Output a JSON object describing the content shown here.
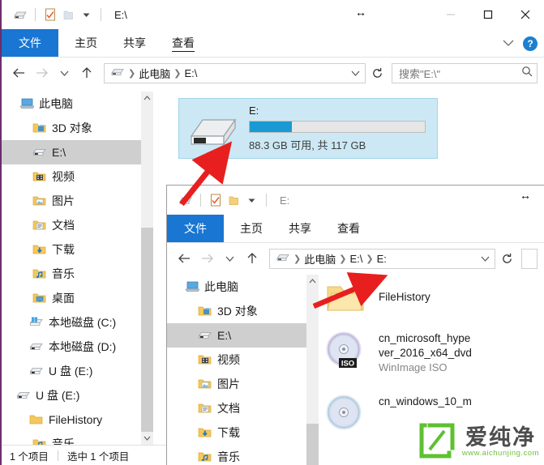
{
  "outer_window": {
    "title": "E:\\",
    "quick_access": [
      {
        "name": "drive-icon",
        "label": ""
      },
      {
        "name": "properties-icon",
        "label": ""
      },
      {
        "name": "new-folder-icon",
        "label": ""
      },
      {
        "name": "customize-dropdown-icon",
        "label": "▾"
      }
    ],
    "caption": {
      "minimize": "—",
      "maximize": "☐",
      "close": "✕"
    },
    "ribbon": {
      "tabs": [
        {
          "label": "文件",
          "active": true
        },
        {
          "label": "主页",
          "active": false
        },
        {
          "label": "共享",
          "active": false
        },
        {
          "label": "查看",
          "active": false
        }
      ],
      "collapse_label": "⌄",
      "help_label": "?"
    },
    "nav": {
      "back": "←",
      "forward": "→",
      "recent": "⌄",
      "up": "↑",
      "refresh_title": "刷新",
      "breadcrumbs": [
        "此电脑",
        "E:\\"
      ],
      "dropdown": "⌄"
    },
    "search": {
      "placeholder": "搜索\"E:\\\"",
      "icon": "search-icon"
    },
    "tree": [
      {
        "label": "此电脑",
        "icon": "this-pc-icon",
        "indent": 22,
        "selected": false
      },
      {
        "label": "3D 对象",
        "icon": "folder-3d-icon",
        "indent": 38,
        "selected": false
      },
      {
        "label": "E:\\",
        "icon": "usb-drive-icon",
        "indent": 38,
        "selected": true
      },
      {
        "label": "视频",
        "icon": "videos-folder-icon",
        "indent": 38,
        "selected": false
      },
      {
        "label": "图片",
        "icon": "pictures-folder-icon",
        "indent": 38,
        "selected": false
      },
      {
        "label": "文档",
        "icon": "documents-folder-icon",
        "indent": 38,
        "selected": false
      },
      {
        "label": "下载",
        "icon": "downloads-folder-icon",
        "indent": 38,
        "selected": false
      },
      {
        "label": "音乐",
        "icon": "music-folder-icon",
        "indent": 38,
        "selected": false
      },
      {
        "label": "桌面",
        "icon": "desktop-folder-icon",
        "indent": 38,
        "selected": false
      },
      {
        "label": "本地磁盘 (C:)",
        "icon": "windows-drive-icon",
        "indent": 34,
        "selected": false
      },
      {
        "label": "本地磁盘 (D:)",
        "icon": "hard-drive-icon",
        "indent": 34,
        "selected": false
      },
      {
        "label": "U 盘 (E:)",
        "icon": "usb-drive-icon",
        "indent": 34,
        "selected": false
      },
      {
        "label": "U 盘 (E:)",
        "icon": "usb-drive-icon",
        "indent": 18,
        "selected": false
      },
      {
        "label": "FileHistory",
        "icon": "folder-icon",
        "indent": 34,
        "selected": false
      },
      {
        "label": "音乐",
        "icon": "music-folder-icon",
        "indent": 38,
        "selected": false
      }
    ],
    "drive_tile": {
      "name": "E:",
      "free_text": "88.3 GB 可用, 共 117 GB",
      "used_percent": 24,
      "fill_color": "#1a9ad4",
      "selected_bg": "#cce8f4"
    },
    "status": {
      "count": "1 个项目",
      "selected": "选中 1 个项目"
    }
  },
  "inner_window": {
    "title": "E:",
    "quick_access": [
      {
        "name": "drive-icon",
        "label": ""
      },
      {
        "name": "properties-icon",
        "label": ""
      },
      {
        "name": "new-folder-icon",
        "label": ""
      },
      {
        "name": "customize-dropdown-icon",
        "label": "▾"
      }
    ],
    "ribbon": {
      "tabs": [
        {
          "label": "文件",
          "active": true
        },
        {
          "label": "主页",
          "active": false
        },
        {
          "label": "共享",
          "active": false
        },
        {
          "label": "查看",
          "active": false
        }
      ]
    },
    "nav": {
      "back": "←",
      "forward": "→",
      "recent": "⌄",
      "up": "↑",
      "breadcrumbs": [
        "此电脑",
        "E:\\",
        "E:"
      ],
      "dropdown": "⌄"
    },
    "tree": [
      {
        "label": "此电脑",
        "icon": "this-pc-icon",
        "indent": 22,
        "selected": false
      },
      {
        "label": "3D 对象",
        "icon": "folder-3d-icon",
        "indent": 38,
        "selected": false
      },
      {
        "label": "E:\\",
        "icon": "usb-drive-icon",
        "indent": 38,
        "selected": true
      },
      {
        "label": "视频",
        "icon": "videos-folder-icon",
        "indent": 38,
        "selected": false
      },
      {
        "label": "图片",
        "icon": "pictures-folder-icon",
        "indent": 38,
        "selected": false
      },
      {
        "label": "文档",
        "icon": "documents-folder-icon",
        "indent": 38,
        "selected": false
      },
      {
        "label": "下载",
        "icon": "downloads-folder-icon",
        "indent": 38,
        "selected": false
      },
      {
        "label": "音乐",
        "icon": "music-folder-icon",
        "indent": 38,
        "selected": false
      }
    ],
    "files": [
      {
        "name": "FileHistory",
        "sub": "",
        "icon": "folder-icon"
      },
      {
        "name": "cn_microsoft_hype",
        "name2": "ver_2016_x64_dvd",
        "sub": "WinImage ISO",
        "icon": "iso-disc-icon"
      },
      {
        "name": "cn_windows_10_m",
        "sub": "",
        "icon": "iso-disc-icon"
      }
    ]
  },
  "watermark": {
    "cn": "爱纯净",
    "url": "www.aichunjing.com",
    "accent": "#5fc031"
  },
  "cursors": {
    "resize_outer": "↔",
    "resize_inner": "↔"
  }
}
